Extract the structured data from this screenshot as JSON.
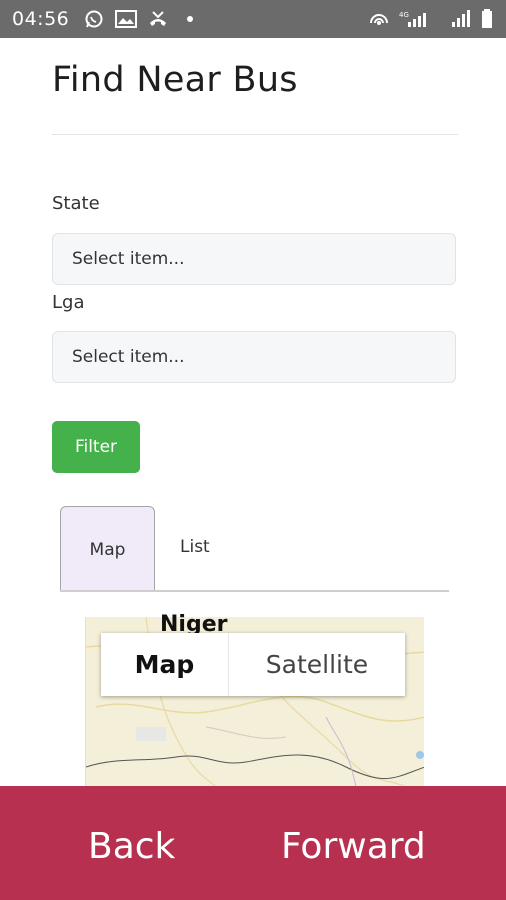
{
  "statusbar": {
    "time": "04:56",
    "left_icons": [
      "whatsapp-icon",
      "gallery-icon",
      "missed-call-icon",
      "dot-icon"
    ],
    "right_icons": [
      "hotspot-icon",
      "signal-icon",
      "signal-icon-2",
      "battery-icon"
    ]
  },
  "page": {
    "title": "Find Near Bus"
  },
  "form": {
    "state_label": "State",
    "state_value": "Select item...",
    "lga_label": "Lga",
    "lga_value": "Select item...",
    "filter_label": "Filter"
  },
  "tabs": [
    {
      "label": "Map",
      "active": true
    },
    {
      "label": "List",
      "active": false
    }
  ],
  "map": {
    "region_label": "Niger",
    "toggle": {
      "map_label": "Map",
      "satellite_label": "Satellite",
      "selected": "Map"
    }
  },
  "bottom_nav": {
    "back_label": "Back",
    "forward_label": "Forward"
  },
  "colors": {
    "statusbar": "#6b6b6b",
    "filter_button": "#44b14a",
    "active_tab": "#f1eaf8",
    "bottom_bar": "#b8304f",
    "map_land": "#f4efd8"
  }
}
